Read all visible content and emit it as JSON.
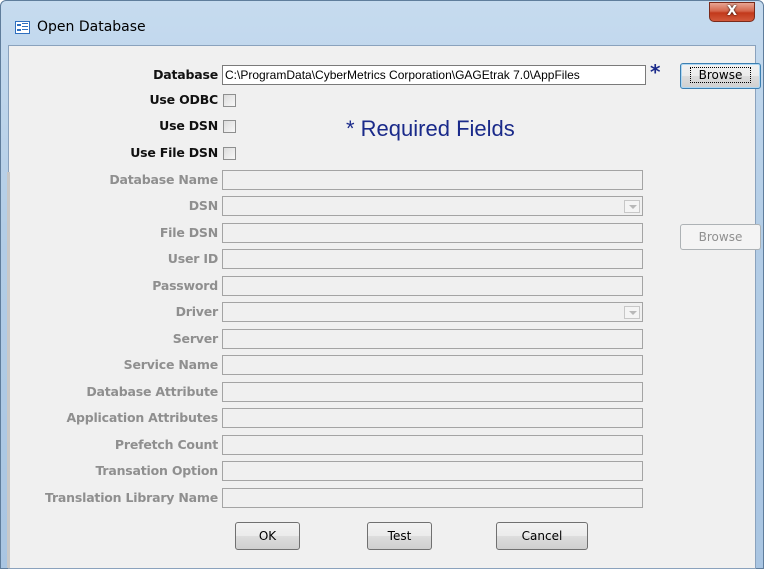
{
  "window": {
    "title": "Open Database",
    "close_glyph": "X"
  },
  "form": {
    "database_label": "Database",
    "database_value": "C:\\ProgramData\\CyberMetrics Corporation\\GAGEtrak 7.0\\AppFiles",
    "required_marker": "*",
    "required_note": "*  Required Fields",
    "use_odbc_label": "Use ODBC",
    "use_dsn_label": "Use DSN",
    "use_file_dsn_label": "Use File DSN",
    "database_name_label": "Database Name",
    "dsn_label": "DSN",
    "file_dsn_label": "File DSN",
    "user_id_label": "User ID",
    "password_label": "Password",
    "driver_label": "Driver",
    "server_label": "Server",
    "service_name_label": "Service Name",
    "database_attribute_label": "Database Attribute",
    "application_attributes_label": "Application Attributes",
    "prefetch_count_label": "Prefetch Count",
    "transation_option_label": "Transation Option",
    "translation_library_name_label": "Translation Library Name"
  },
  "buttons": {
    "browse_database": "Browse",
    "browse_file_dsn": "Browse",
    "ok": "OK",
    "test": "Test",
    "cancel": "Cancel"
  },
  "checkboxes": {
    "use_odbc": false,
    "use_dsn": false,
    "use_file_dsn": false
  },
  "colors": {
    "required_text": "#1a2a8a",
    "disabled_text": "#8f8f8f",
    "close_button": "#c2391b"
  },
  "icons": {
    "title": "form-window-icon",
    "close": "close-icon",
    "dropdown": "chevron-down-icon"
  }
}
